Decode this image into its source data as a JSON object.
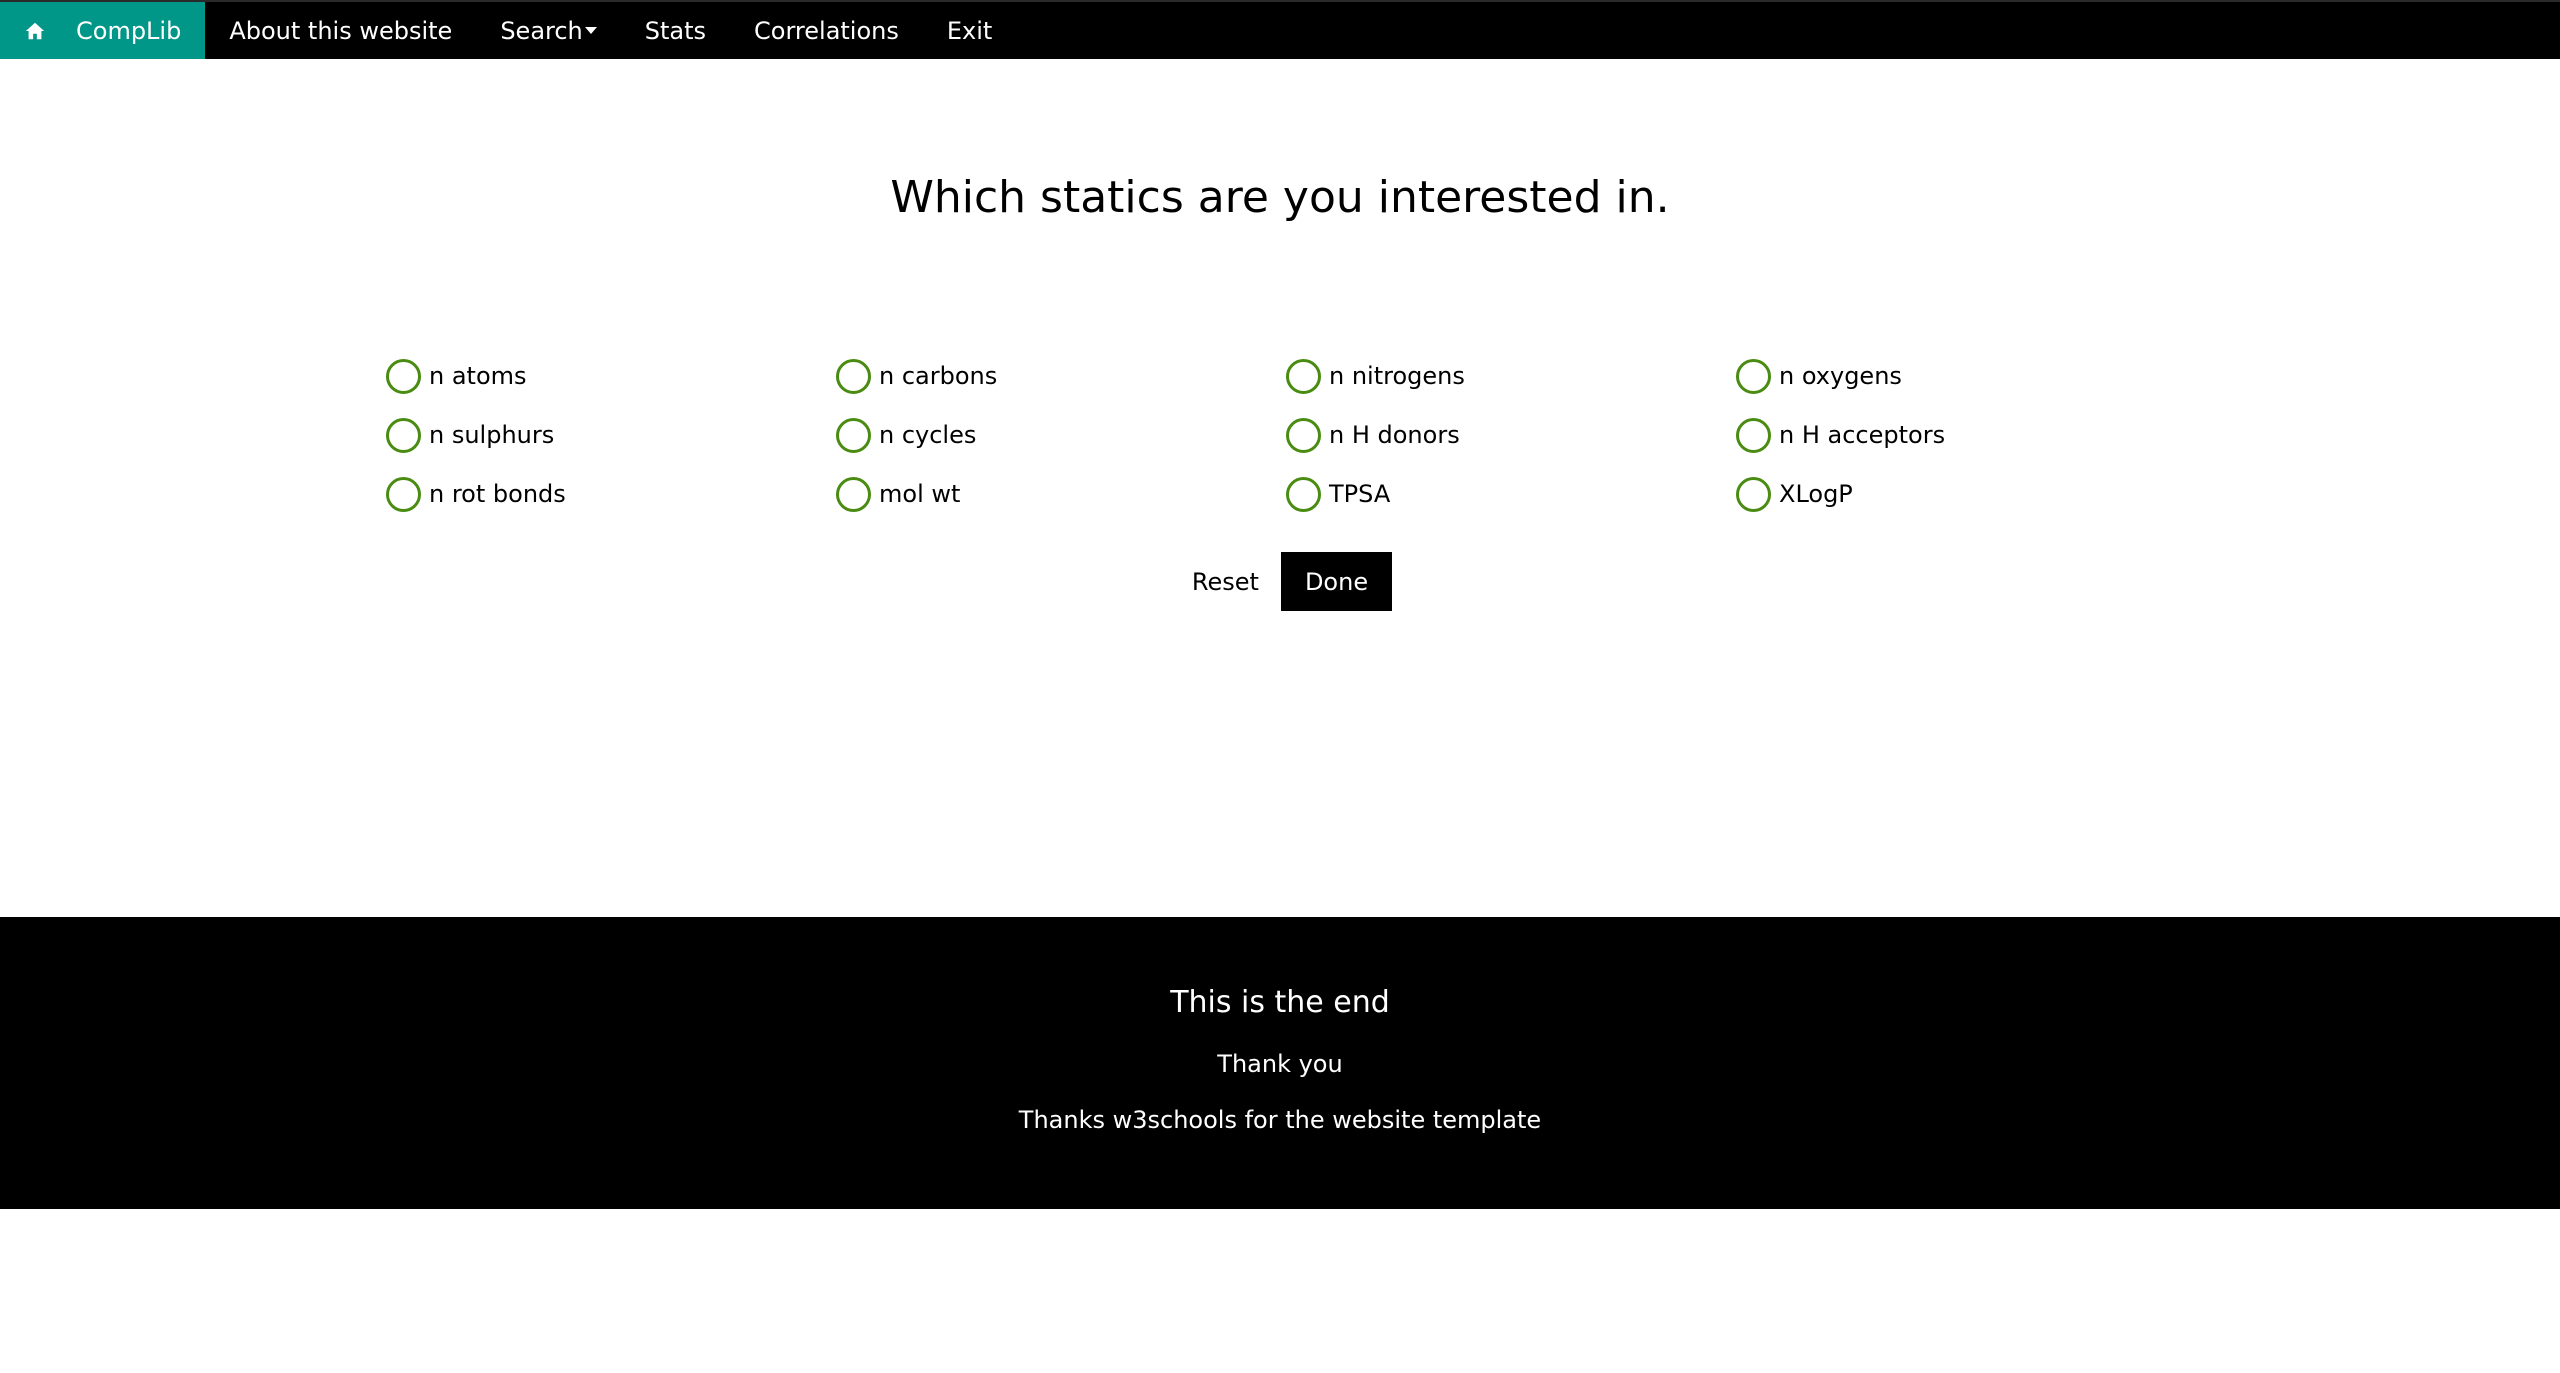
{
  "nav": {
    "brand": "CompLib",
    "home_icon": "home-icon",
    "items": [
      {
        "label": "About this website"
      },
      {
        "label": "Search",
        "has_dropdown": true
      },
      {
        "label": "Stats"
      },
      {
        "label": "Correlations"
      },
      {
        "label": "Exit"
      }
    ]
  },
  "heading": "Which statics are you interested in.",
  "options": [
    {
      "label": "n atoms",
      "checked": false
    },
    {
      "label": "n carbons",
      "checked": false
    },
    {
      "label": "n nitrogens",
      "checked": false
    },
    {
      "label": "n oxygens",
      "checked": false
    },
    {
      "label": "n sulphurs",
      "checked": false
    },
    {
      "label": "n cycles",
      "checked": false
    },
    {
      "label": "n H donors",
      "checked": false
    },
    {
      "label": "n H acceptors",
      "checked": false
    },
    {
      "label": "n rot bonds",
      "checked": false
    },
    {
      "label": "mol wt",
      "checked": false
    },
    {
      "label": "TPSA",
      "checked": false
    },
    {
      "label": "XLogP",
      "checked": false
    }
  ],
  "buttons": {
    "reset": "Reset",
    "done": "Done"
  },
  "footer": {
    "title": "This is the end",
    "line1": "Thank you",
    "line2": "Thanks w3schools for the website template"
  },
  "colors": {
    "brand": "#009688",
    "navbar": "#000000",
    "radio_border": "#4a8c12",
    "footer": "#000000"
  }
}
